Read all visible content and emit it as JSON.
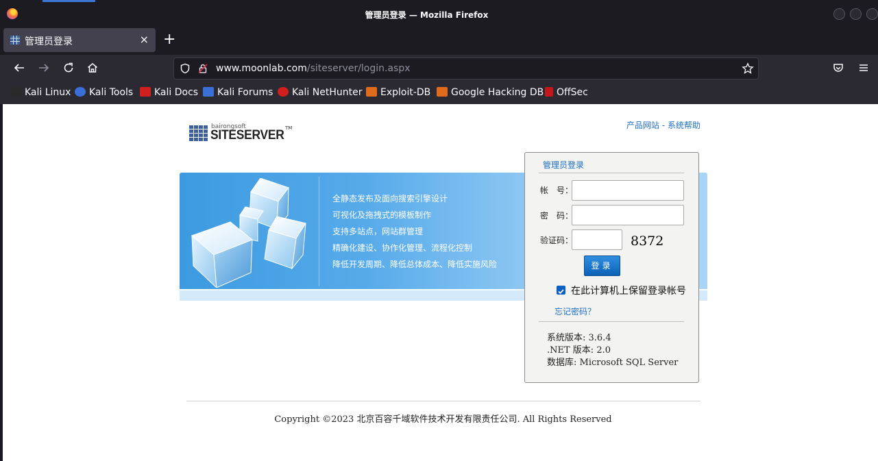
{
  "browser": {
    "window_title": "管理员登录 — Mozilla Firefox",
    "tab_title": "管理员登录",
    "tab_close": "×",
    "new_tab": "+",
    "url_host": "www.moonlab.com",
    "url_path": "/siteserver/login.aspx"
  },
  "bookmarks": [
    {
      "label": "Kali Linux",
      "color": "#2a2a2a"
    },
    {
      "label": "Kali Tools",
      "color": "#3b6fd8"
    },
    {
      "label": "Kali Docs",
      "color": "#d11f1f"
    },
    {
      "label": "Kali Forums",
      "color": "#3b6fd8"
    },
    {
      "label": "Kali NetHunter",
      "color": "#d11f1f"
    },
    {
      "label": "Exploit-DB",
      "color": "#e06b1c"
    },
    {
      "label": "Google Hacking DB",
      "color": "#e06b1c"
    },
    {
      "label": "OffSec",
      "color": "#c4161c"
    }
  ],
  "logo": {
    "small": "bairongsoft",
    "big": "SITESERVER",
    "tm": "TM"
  },
  "top_links": "产品网站 - 系统帮助",
  "features": [
    "全静态发布及面向搜索引擎设计",
    "可视化及拖拽式的模板制作",
    "支持多站点，网站群管理",
    "精确化建设、协作化管理、流程化控制",
    "降低开发周期、降低总体成本、降低实施风险"
  ],
  "login": {
    "title": "管理员登录",
    "account_label": "帐　号：",
    "password_label": "密　码：",
    "captcha_label": "验证码：",
    "captcha_code": "8372",
    "submit": "登录",
    "remember_label": "在此计算机上保留登录帐号",
    "forgot": "忘记密码？",
    "version": "系统版本: 3.6.4",
    "net_version": ".NET 版本: 2.0",
    "database": "数据库: Microsoft SQL Server"
  },
  "footer": "Copyright ©2023 北京百容千域软件技术开发有限责任公司. All Rights Reserved",
  "colors": {
    "link": "#1d6fc4",
    "banner": "#56aaea",
    "button": "#0d62b6"
  }
}
